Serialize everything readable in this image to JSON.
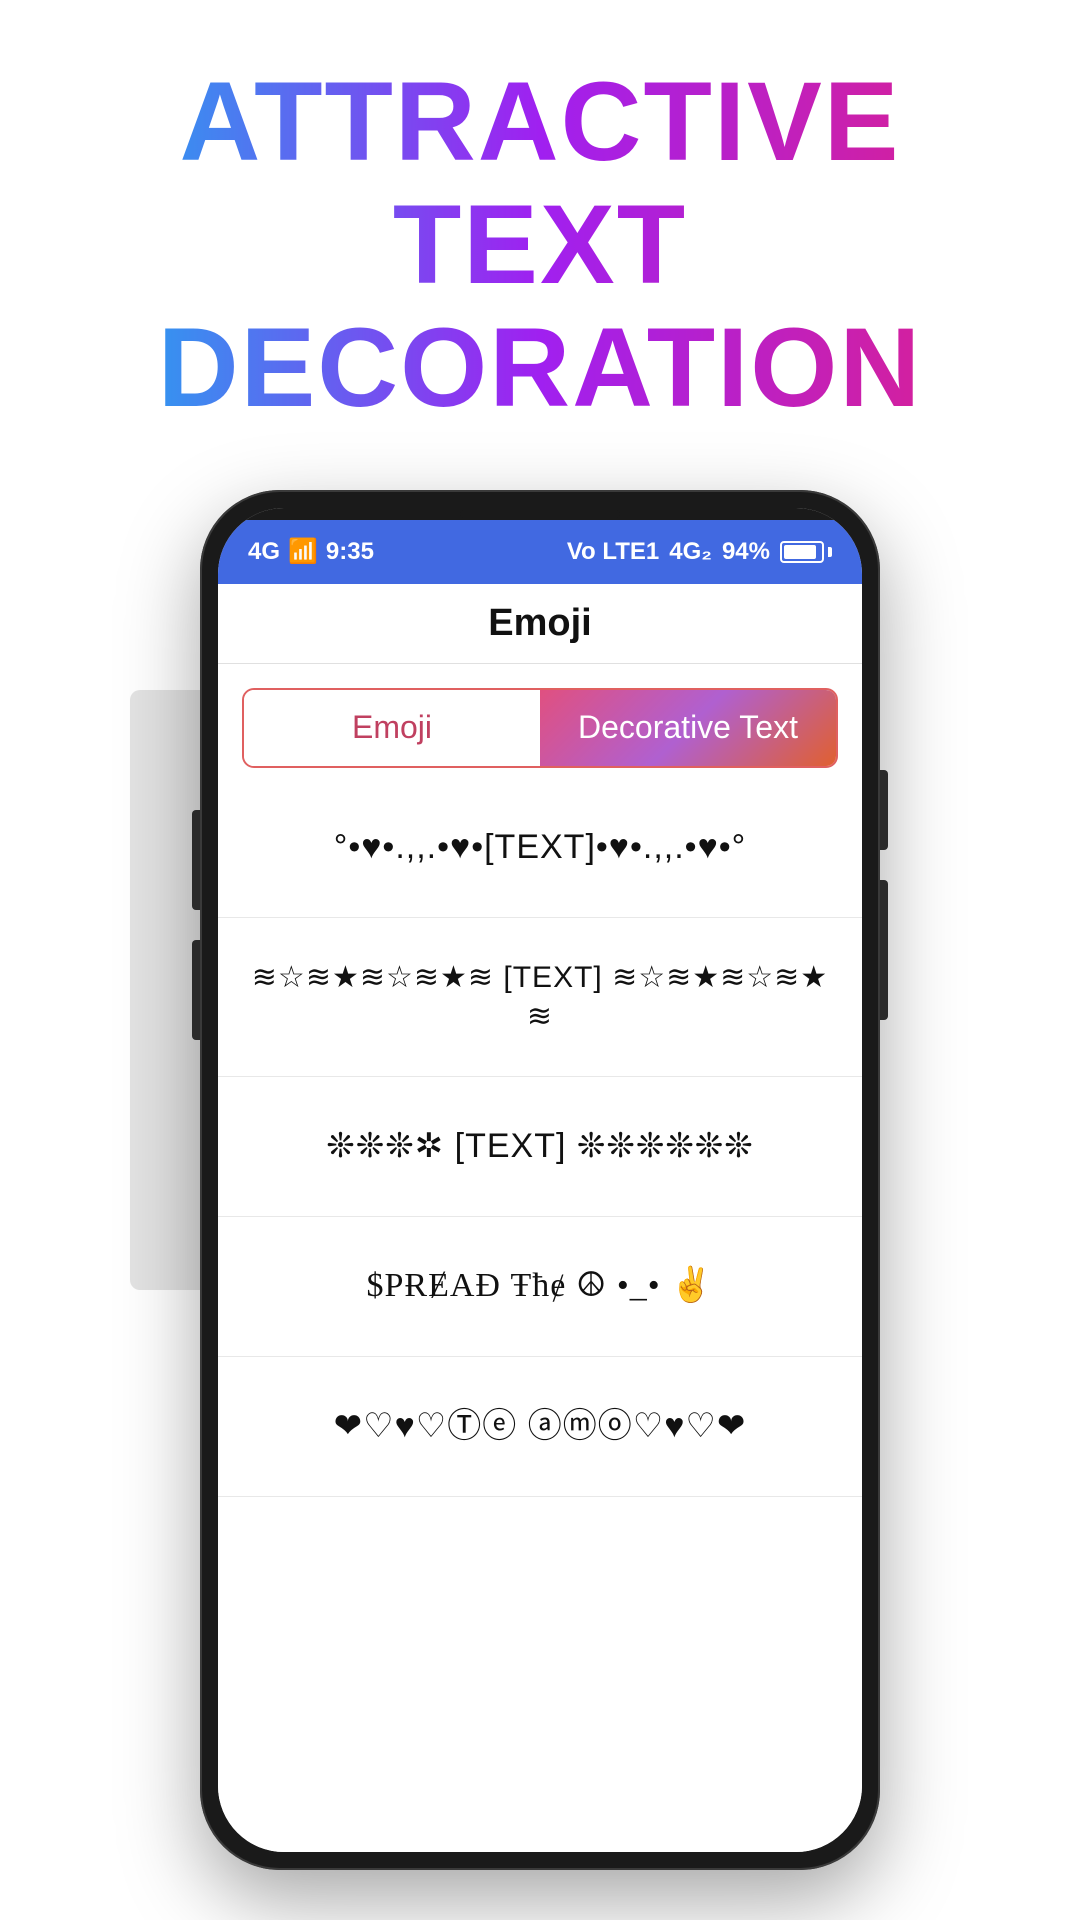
{
  "page": {
    "background": "#ffffff"
  },
  "title": {
    "line1": "ATTRACTIVE TEXT",
    "line2": "DECORATION"
  },
  "phone": {
    "statusBar": {
      "time": "9:35",
      "signals": "4G  4G",
      "network": "Vo LTE1  4G₂",
      "battery": "94%"
    },
    "appHeader": {
      "title": "Emoji"
    },
    "tabs": [
      {
        "label": "Emoji",
        "active": false
      },
      {
        "label": "Decorative Text",
        "active": true
      }
    ],
    "decorativeItems": [
      {
        "id": 1,
        "text": "°•♥•.,,.•♥•[TEXT]•♥•.,,.•♥•°"
      },
      {
        "id": 2,
        "text": "≋☆≋★≋☆≋★≋ [TEXT] ≋☆≋★≋☆≋★≋"
      },
      {
        "id": 3,
        "text": "❊❊❊✲ [TEXT] ❊❊❊❊❊❊"
      },
      {
        "id": 4,
        "text": "$PɌɆAƉ Ŧħɇ ☮ •_• ✌"
      },
      {
        "id": 5,
        "text": "❤♡♥♡Ⓣⓔ ⓐⓜⓞ♡♥♡❤"
      }
    ]
  }
}
